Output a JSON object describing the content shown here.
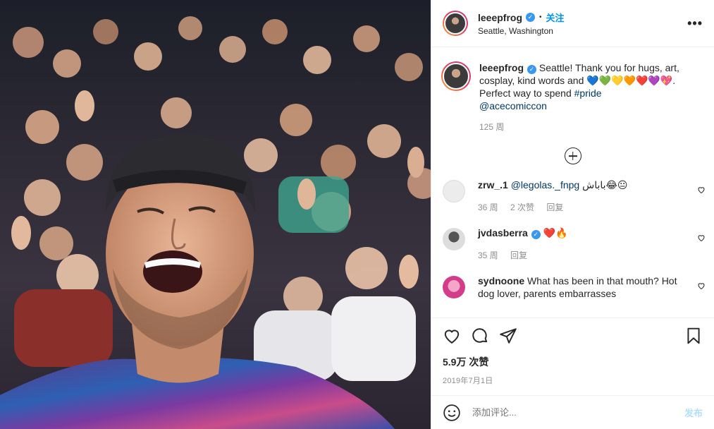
{
  "header": {
    "username": "leeepfrog",
    "separator": "•",
    "follow_label": "关注",
    "location": "Seattle, Washington",
    "more_label": "•••"
  },
  "caption": {
    "username": "leeepfrog",
    "text_before": "Seattle! Thank you for hugs, art, cosplay, kind words and ",
    "emojis": "💙💚💛🧡❤️💜💖",
    "text_after": ". Perfect way to spend ",
    "hashtag": "#pride",
    "mention": "@acecomiccon",
    "time": "125 周"
  },
  "comments": [
    {
      "username": "zrw_.1",
      "mention": "@legolas._fnpg",
      "text": " باباش😂😐",
      "time": "36 周",
      "likes": "2 次赞",
      "reply": "回复",
      "avatar_color": "#e8e8e8"
    },
    {
      "username": "jvdasberra",
      "text": "❤️🔥",
      "time": "35 周",
      "reply": "回复",
      "avatar_color": "#cfcfcf"
    },
    {
      "username": "sydnoone",
      "text": "What has been in that mouth? Hot dog lover, parents embarrasses",
      "avatar_color": "#d23c8a"
    }
  ],
  "actions": {
    "likes": "5.9万 次赞",
    "date": "2019年7月1日"
  },
  "add_comment": {
    "placeholder": "添加评论...",
    "post_label": "发布"
  },
  "colors": {
    "link": "#0095f6",
    "hashtag": "#00376b",
    "verified": "#3897f0",
    "muted": "#8e8e8e"
  }
}
